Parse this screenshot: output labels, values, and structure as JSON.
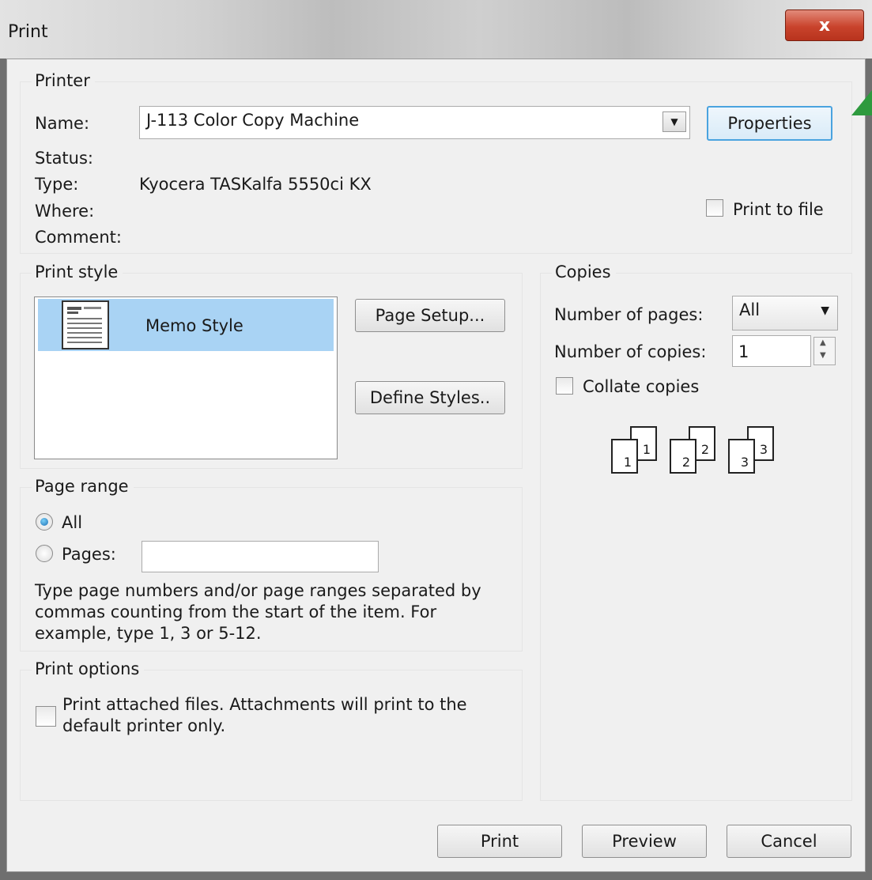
{
  "window": {
    "title": "Print",
    "close_label": "x"
  },
  "printer": {
    "group_label": "Printer",
    "name_label": "Name:",
    "name_value": "J-113 Color Copy Machine",
    "properties_button": "Properties",
    "status_label": "Status:",
    "type_label": "Type:",
    "type_value": "Kyocera TASKalfa 5550ci KX",
    "where_label": "Where:",
    "comment_label": "Comment:",
    "print_to_file_label": "Print to file",
    "print_to_file_checked": false
  },
  "print_style": {
    "group_label": "Print style",
    "items": [
      {
        "label": "Memo Style",
        "selected": true
      }
    ],
    "page_setup_button": "Page Setup...",
    "define_styles_button": "Define Styles.."
  },
  "copies": {
    "group_label": "Copies",
    "number_of_pages_label": "Number of pages:",
    "number_of_pages_value": "All",
    "number_of_copies_label": "Number of copies:",
    "number_of_copies_value": "1",
    "collate_label": "Collate copies",
    "collate_checked": false,
    "collate_illustration": [
      "1",
      "1",
      "2",
      "2",
      "3",
      "3"
    ]
  },
  "page_range": {
    "group_label": "Page range",
    "all_label": "All",
    "all_selected": true,
    "pages_label": "Pages:",
    "pages_value": "",
    "hint_line1": "Type page numbers and/or page ranges separated by",
    "hint_line2": "commas counting from the start of the item.  For",
    "hint_line3": "example, type 1, 3 or 5-12."
  },
  "print_options": {
    "group_label": "Print options",
    "attach_line1": "Print attached files.  Attachments will print to the",
    "attach_line2": "default printer only.",
    "attach_checked": false
  },
  "buttons": {
    "print": "Print",
    "preview": "Preview",
    "cancel": "Cancel"
  }
}
